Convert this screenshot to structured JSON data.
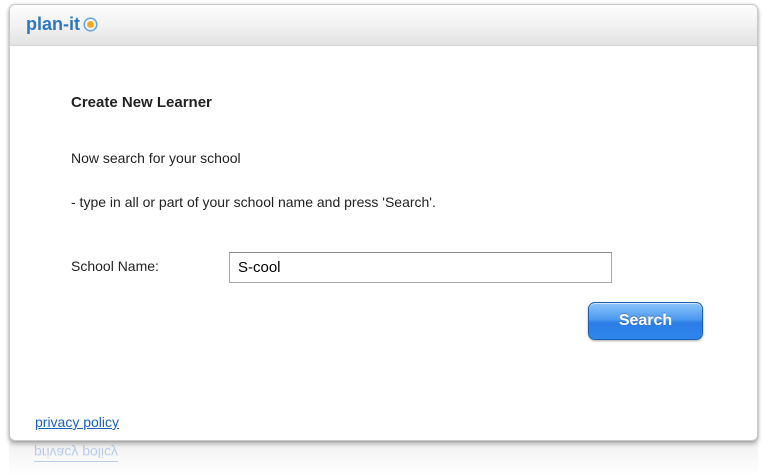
{
  "header": {
    "logo_text": "plan-it"
  },
  "form": {
    "heading": "Create New Learner",
    "instruction_line1": "Now search for your school",
    "instruction_line2": "- type in all or part of your school name and press 'Search'.",
    "school_name_label": "School Name:",
    "school_name_value": "S-cool",
    "search_button_label": "Search"
  },
  "footer": {
    "privacy_link": "privacy policy"
  },
  "colors": {
    "brand_blue": "#2e77c4",
    "button_blue": "#2b7de6",
    "logo_orange": "#f5a623",
    "link_blue": "#1a5fc4"
  },
  "icons": {
    "logo_mark": "target-icon"
  }
}
